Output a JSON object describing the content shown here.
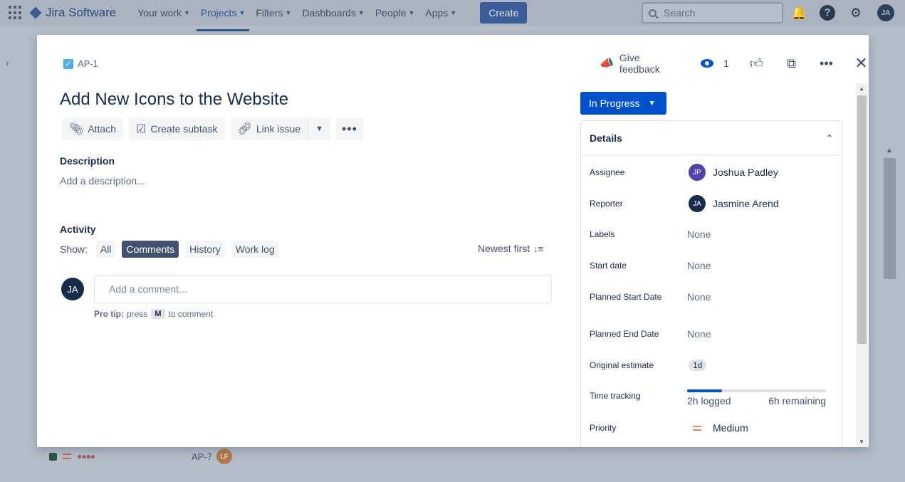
{
  "nav": {
    "brand": "Jira Software",
    "items": [
      {
        "label": "Your work"
      },
      {
        "label": "Projects"
      },
      {
        "label": "Filters"
      },
      {
        "label": "Dashboards"
      },
      {
        "label": "People"
      },
      {
        "label": "Apps"
      }
    ],
    "active_item": "Projects",
    "create_label": "Create",
    "search_placeholder": "Search",
    "avatar": "JA"
  },
  "background": {
    "row_key": "AP-7",
    "row_assignee": "LF"
  },
  "issue": {
    "key": "AP-1",
    "title": "Add New Icons to the Website",
    "feedback_label": "Give feedback",
    "watch_count": "1"
  },
  "toolbar": {
    "attach": "Attach",
    "create_subtask": "Create subtask",
    "link_issue": "Link issue"
  },
  "description": {
    "heading": "Description",
    "placeholder": "Add a description..."
  },
  "activity": {
    "heading": "Activity",
    "show_label": "Show:",
    "filters": [
      "All",
      "Comments",
      "History",
      "Work log"
    ],
    "selected_filter": "Comments",
    "sort_label": "Newest first",
    "comment_avatar": "JA",
    "comment_placeholder": "Add a comment...",
    "protip_bold": "Pro tip:",
    "protip_pre": "press",
    "protip_key": "M",
    "protip_post": "to comment"
  },
  "status": {
    "label": "In Progress"
  },
  "details": {
    "heading": "Details",
    "fields": [
      {
        "label": "Assignee",
        "value": "Joshua Padley",
        "initials": "JP",
        "color": "#5243aa"
      },
      {
        "label": "Reporter",
        "value": "Jasmine Arend",
        "initials": "JA",
        "color": "#172b4d"
      },
      {
        "label": "Labels",
        "value": "None"
      },
      {
        "label": "Start date",
        "value": "None"
      },
      {
        "label": "Planned Start Date",
        "value": "None"
      },
      {
        "label": "Planned End Date",
        "value": "None"
      },
      {
        "label": "Original estimate",
        "value": "1d"
      },
      {
        "label": "Time tracking"
      },
      {
        "label": "Priority",
        "value": "Medium"
      }
    ],
    "time_tracking": {
      "logged": "2h logged",
      "remaining": "6h remaining",
      "progress_fraction": 0.25
    }
  },
  "colors": {
    "primary": "#0052cc",
    "priority_medium": "#e08c52"
  }
}
